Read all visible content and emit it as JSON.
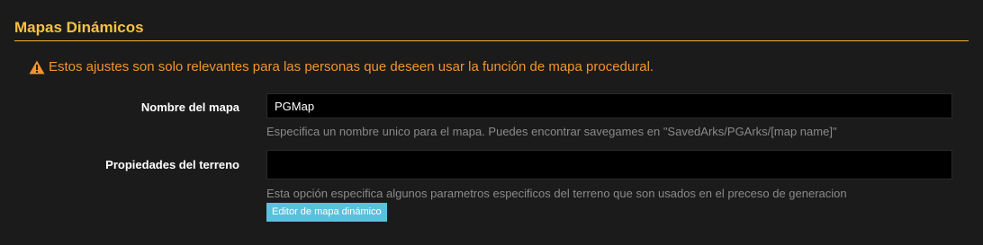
{
  "section": {
    "title": "Mapas Dinámicos"
  },
  "warning": {
    "icon": "warning-triangle-icon",
    "text": "Estos ajustes son solo relevantes para las personas que deseen usar la función de mapa procedural."
  },
  "fields": {
    "map_name": {
      "label": "Nombre del mapa",
      "value": "PGMap",
      "help": "Especifica un nombre unico para el mapa. Puedes encontrar savegames en \"SavedArks/PGArks/[map name]\""
    },
    "terrain": {
      "label": "Propiedades del terreno",
      "value": "",
      "help": "Esta opción especifica algunos parametros especificos del terreno que son usados en el preceso de generacion"
    }
  },
  "buttons": {
    "dynamic_map_editor": "Editor de mapa dinámico"
  },
  "colors": {
    "accent": "#f5c242",
    "warning": "#f0952d",
    "button": "#5bc0de",
    "input_bg": "#000000",
    "help_text": "#8a8a8a"
  }
}
